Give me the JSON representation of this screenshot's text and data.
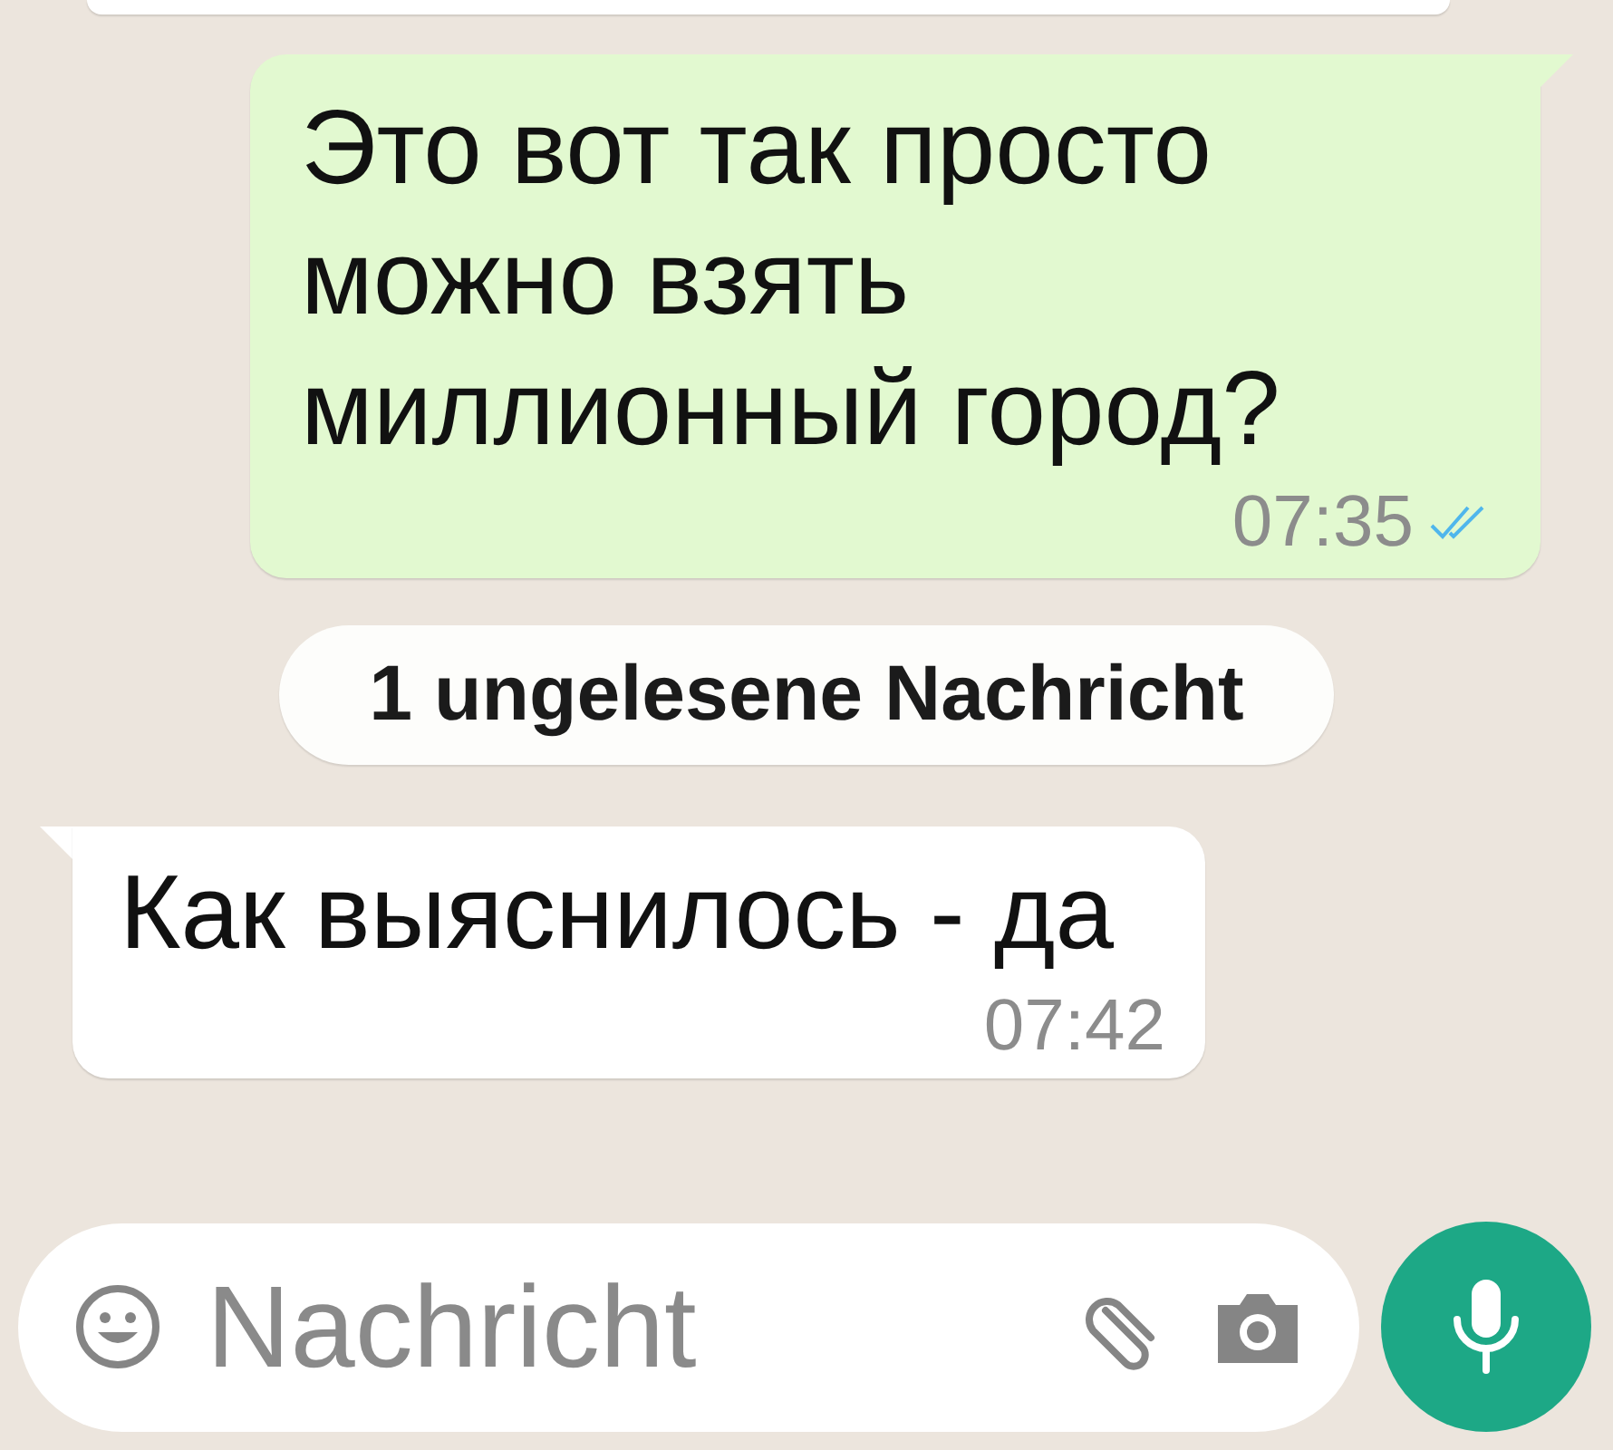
{
  "messages": [
    {
      "kind": "outgoing",
      "text": "Это вот так просто можно взять миллионный город?",
      "time": "07:35",
      "read": true
    },
    {
      "kind": "unread_banner",
      "text": "1 ungelesene Nachricht"
    },
    {
      "kind": "incoming",
      "text": "Как выяснилось - да",
      "time": "07:42"
    }
  ],
  "composer": {
    "placeholder": "Nachricht"
  }
}
